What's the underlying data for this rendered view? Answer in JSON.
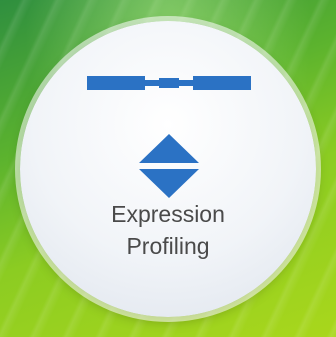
{
  "tile": {
    "label_line1": "Expression",
    "label_line2": "Profiling",
    "icons": [
      "gene-track-icon",
      "up-down-arrows-icon"
    ],
    "colors": {
      "accent": "#2b72c4",
      "text": "#4a4a4a",
      "background": "#8ccc22"
    }
  }
}
